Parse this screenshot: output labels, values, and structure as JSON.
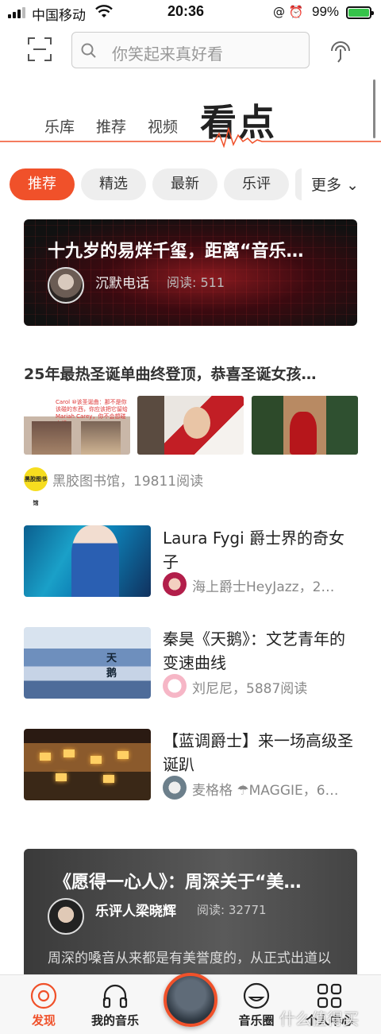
{
  "status_bar": {
    "carrier": "中国移动",
    "time": "20:36",
    "battery": "99%"
  },
  "search": {
    "placeholder": "你笑起来真好看"
  },
  "nav": {
    "items": [
      {
        "label": "乐库"
      },
      {
        "label": "推荐"
      },
      {
        "label": "视频"
      }
    ],
    "active": "看点"
  },
  "chips": [
    {
      "label": "推荐",
      "active": true
    },
    {
      "label": "精选"
    },
    {
      "label": "最新"
    },
    {
      "label": "乐评"
    }
  ],
  "chips_more": "更多",
  "feature": {
    "title": "十九岁的易烊千玺，距离“音乐…",
    "author": "沉默电话",
    "reads": "阅读: 511"
  },
  "article2": {
    "title": "25年最热圣诞单曲终登顶，恭喜圣诞女孩…",
    "thumb1_text": "Carol ⑩该圣诞曲：那不是你该碰的东西，你应该把它留给Mariah Carey，你不会想碰它们",
    "logo_text": "黑胶图书馆",
    "meta": "黑胶图书馆，19811阅读"
  },
  "list": [
    {
      "title": "Laura Fygi 爵士界的奇女子",
      "meta": "海上爵士HeyJazz，2…"
    },
    {
      "title": "秦昊《天鹅》：文艺青年的变速曲线",
      "meta": "刘尼尼，5887阅读",
      "image_text": "天鹅"
    },
    {
      "title": "【蓝调爵士】来一场高级圣诞趴",
      "meta": "麦格格 ☂MAGGIE，6…"
    }
  ],
  "card2": {
    "title": "《愿得一心人》：周深关于“美…",
    "author": "乐评人梁晓辉",
    "reads": "阅读: 32771",
    "body": "周深的嗓音从来都是有美誉度的，从正式出道以来，他就有“天籁美音”之称，也是系"
  },
  "tabbar": {
    "items": [
      {
        "label": "发现",
        "icon": "discover-icon",
        "active": true
      },
      {
        "label": "我的音乐",
        "icon": "headphones-icon"
      },
      {
        "label": "音乐圈",
        "icon": "smile-icon"
      },
      {
        "label": "个人中心",
        "icon": "grid-icon"
      }
    ]
  },
  "watermark": "什么值得买",
  "colors": {
    "accent": "#f0512a",
    "battery": "#36c34a"
  }
}
